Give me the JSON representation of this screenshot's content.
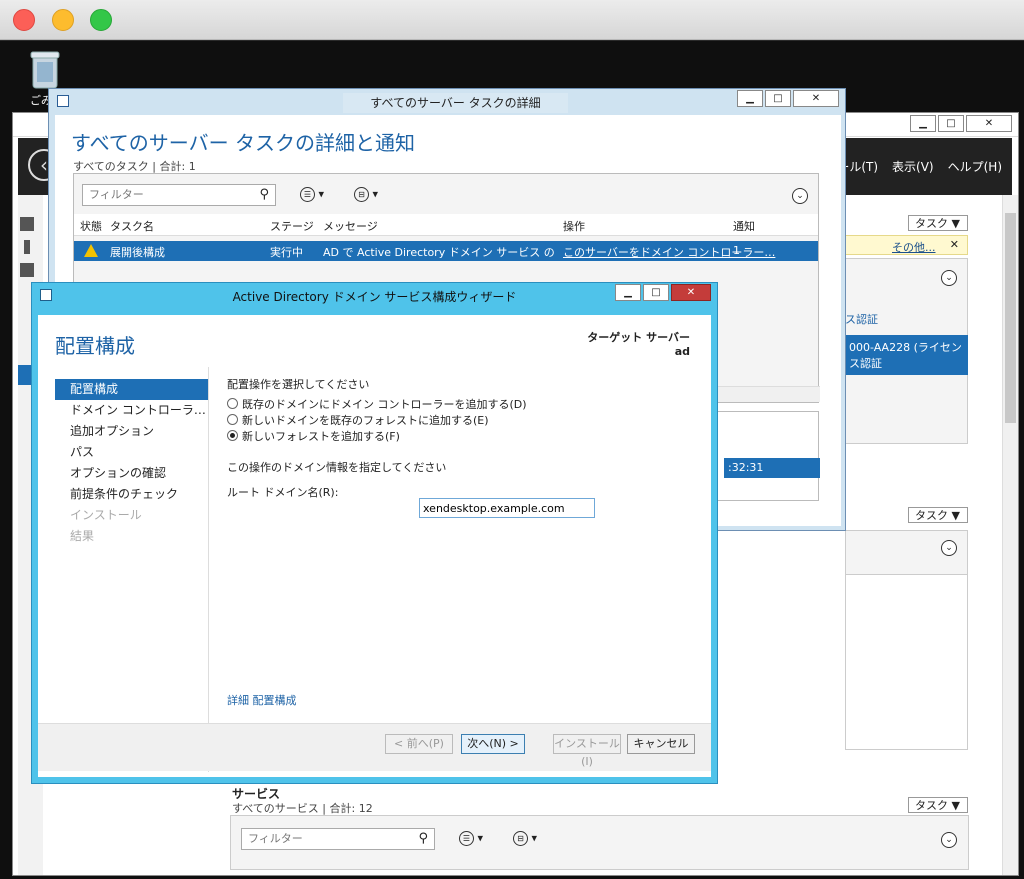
{
  "desktop": {
    "recycle_label": "ごみ"
  },
  "server_manager": {
    "menu": [
      "ール(T)",
      "表示(V)",
      "ヘルプ(H)"
    ],
    "task_dd": "タスク",
    "others_link": "その他...",
    "bg_text_1": "ス認証",
    "bg_text_2": "000-AA228 (ライセンス認証",
    "bg_time": ":32:31",
    "services_title": "サービス",
    "services_sub": "すべてのサービス | 合計: 12",
    "services_filter": "フィルター"
  },
  "task_dialog": {
    "title": "すべてのサーバー タスクの詳細",
    "heading": "すべてのサーバー タスクの詳細と通知",
    "subtitle": "すべてのタスク | 合計: 1",
    "filter_placeholder": "フィルター",
    "columns": [
      "状態",
      "タスク名",
      "ステージ",
      "メッセージ",
      "操作",
      "通知"
    ],
    "row": {
      "task": "展開後構成",
      "stage": "実行中",
      "message": "AD で Active Directory ドメイン サービス の構成…",
      "action": "このサーバーをドメイン コントローラー…",
      "notify": "1"
    }
  },
  "wizard": {
    "title": "Active Directory ドメイン サービス構成ウィザード",
    "heading": "配置構成",
    "target_label": "ターゲット サーバー",
    "target_value": "ad",
    "nav": [
      {
        "label": "配置構成",
        "state": "selected"
      },
      {
        "label": "ドメイン コントローラー オプ…",
        "state": "normal"
      },
      {
        "label": "追加オプション",
        "state": "normal"
      },
      {
        "label": "パス",
        "state": "normal"
      },
      {
        "label": "オプションの確認",
        "state": "normal"
      },
      {
        "label": "前提条件のチェック",
        "state": "normal"
      },
      {
        "label": "インストール",
        "state": "disabled"
      },
      {
        "label": "結果",
        "state": "disabled"
      }
    ],
    "select_op_label": "配置操作を選択してください",
    "options": [
      {
        "label": "既存のドメインにドメイン コントローラーを追加する(D)",
        "checked": false
      },
      {
        "label": "新しいドメインを既存のフォレストに追加する(E)",
        "checked": false
      },
      {
        "label": "新しいフォレストを追加する(F)",
        "checked": true
      }
    ],
    "domain_info_label": "この操作のドメイン情報を指定してください",
    "root_domain_label": "ルート ドメイン名(R):",
    "root_domain_value": "xendesktop.example.com",
    "more_link": "詳細 配置構成",
    "buttons": {
      "prev": "< 前へ(P)",
      "next": "次へ(N) >",
      "install": "インストール(I)",
      "cancel": "キャンセル"
    }
  }
}
